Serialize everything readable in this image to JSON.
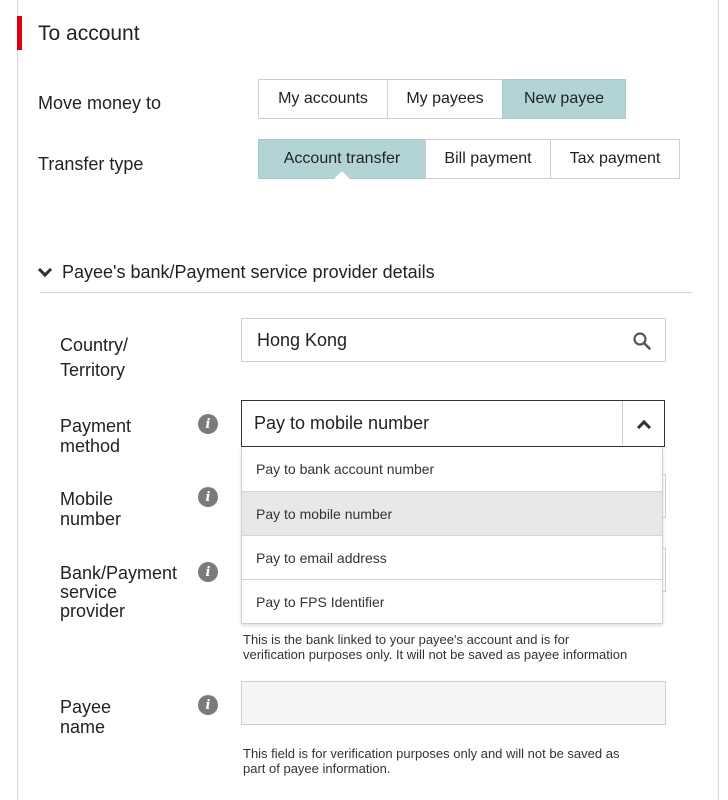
{
  "section": {
    "title": "To account"
  },
  "move_money": {
    "label": "Move money to",
    "options": [
      "My accounts",
      "My payees",
      "New payee"
    ],
    "selected": "New payee"
  },
  "transfer_type": {
    "label": "Transfer type",
    "options": [
      "Account transfer",
      "Bill payment",
      "Tax payment"
    ],
    "selected": "Account transfer"
  },
  "payee_details": {
    "header": "Payee's bank/Payment service provider details"
  },
  "country": {
    "label_line1": "Country/",
    "label_line2": "Territory",
    "value": "Hong Kong"
  },
  "payment_method": {
    "label_line1": "Payment",
    "label_line2": "method",
    "value": "Pay to mobile number",
    "options": [
      "Pay to bank account number",
      "Pay to mobile number",
      "Pay to email address",
      "Pay to FPS Identifier"
    ],
    "highlighted": "Pay to mobile number"
  },
  "mobile": {
    "label_line1": "Mobile",
    "label_line2": "number"
  },
  "bank": {
    "label_line1": "Bank/Payment",
    "label_line2": "service",
    "label_line3": "provider",
    "help_line1": "This is the bank linked to your payee's account and is for",
    "help_line2": "verification purposes only. It will not be saved as payee information"
  },
  "payee_name": {
    "label_line1": "Payee",
    "label_line2": "name",
    "value": "",
    "help_line1": "This field is for verification purposes only and will not be saved as",
    "help_line2": "part of payee information."
  },
  "colors": {
    "accent": "#db0011",
    "selected_bg": "#b3d4d5"
  },
  "icons": {
    "info": "info-icon",
    "search": "search-icon",
    "chevron_down": "chevron-down-icon",
    "chevron_up": "chevron-up-icon"
  }
}
